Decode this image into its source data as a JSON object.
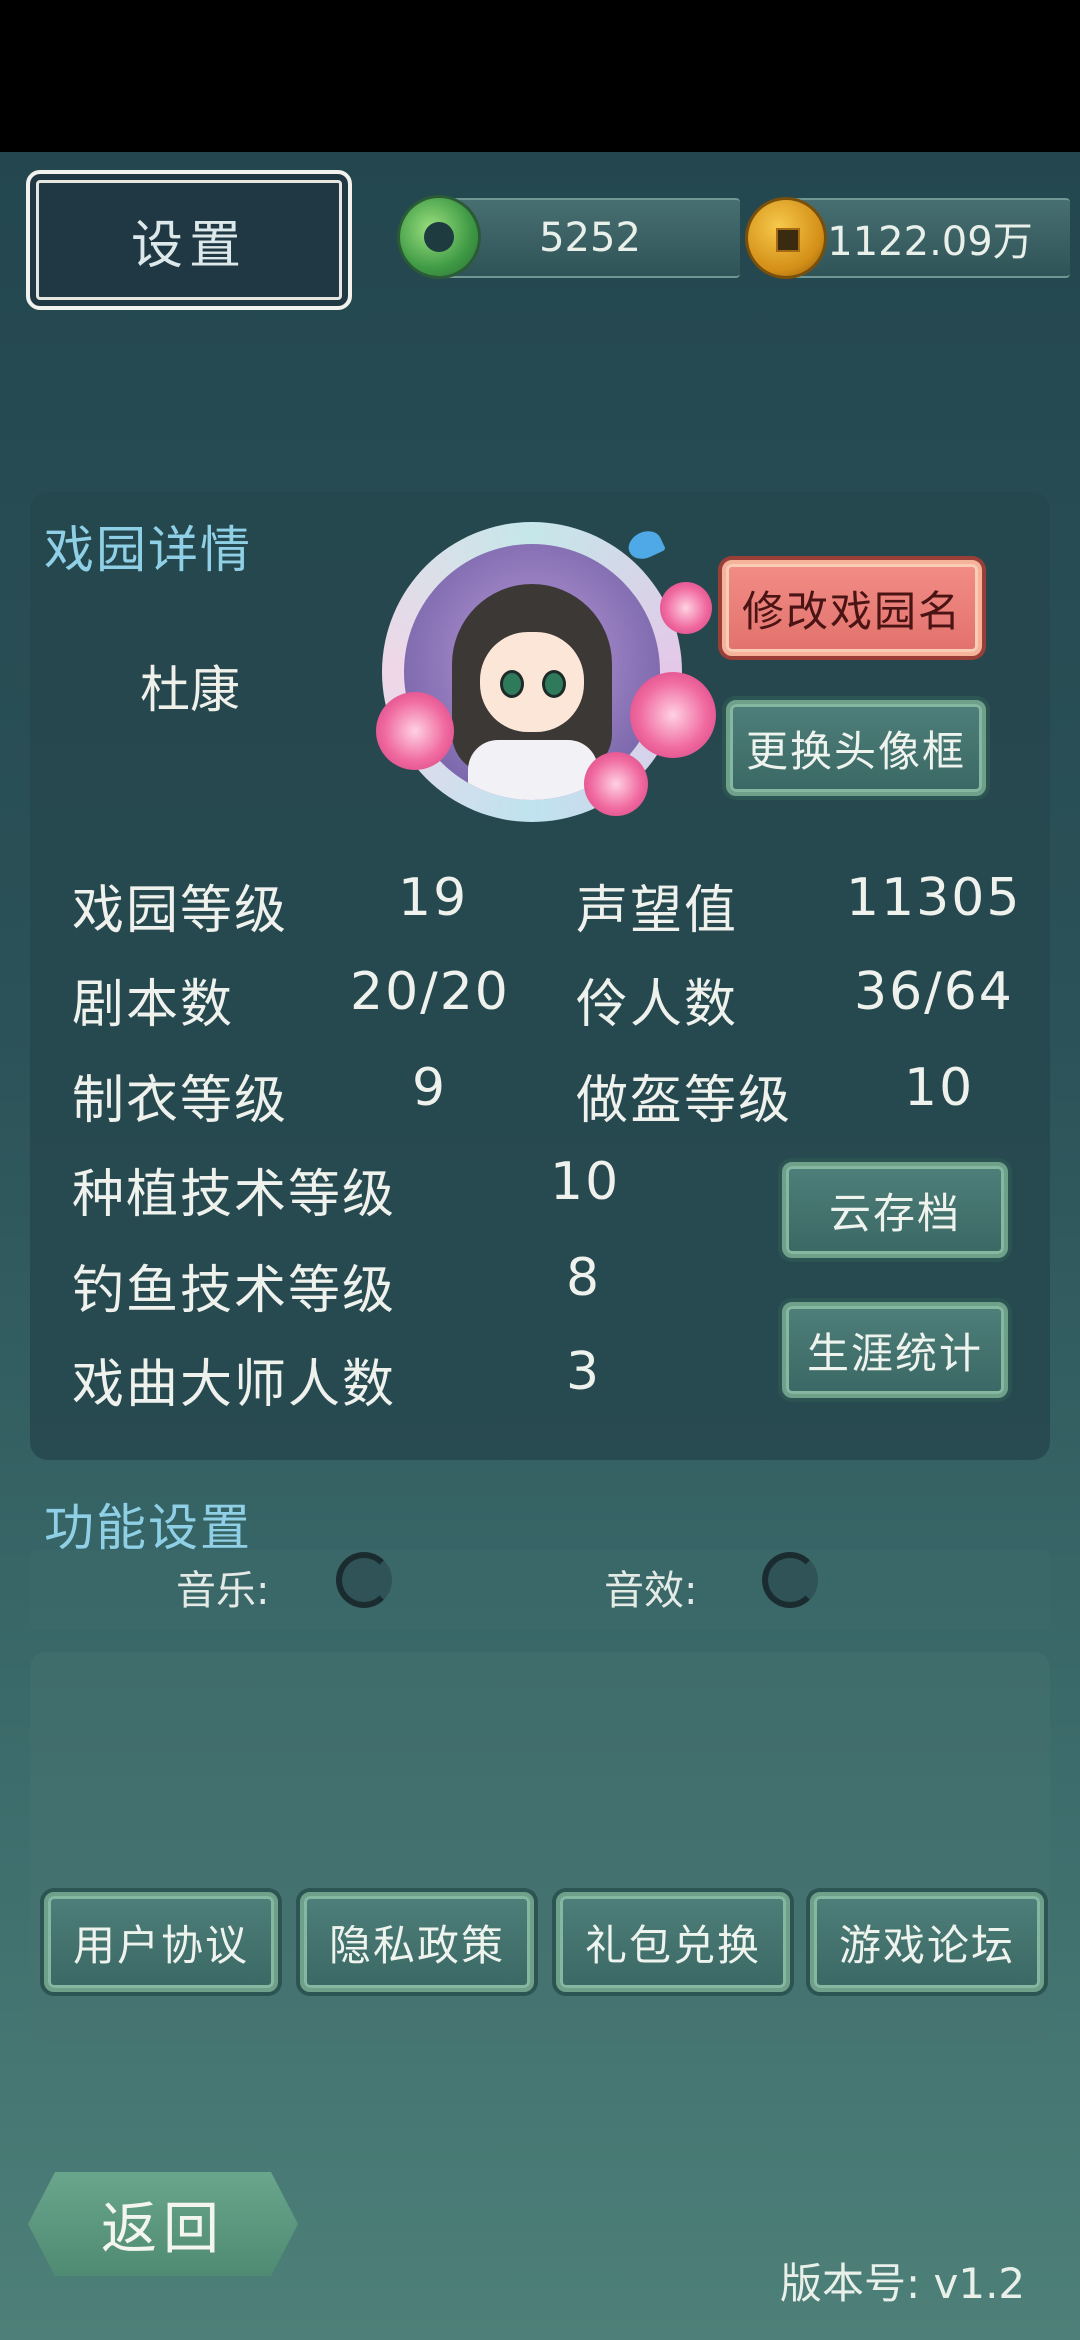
{
  "header": {
    "title": "设置",
    "jade_amount": "5252",
    "coin_amount": "1122.09万"
  },
  "details": {
    "section_title": "戏园详情",
    "garden_name": "杜康",
    "rename_button": "修改戏园名",
    "change_frame_button": "更换头像框",
    "stats": [
      {
        "label": "戏园等级",
        "value": "19"
      },
      {
        "label": "声望值",
        "value": "11305"
      },
      {
        "label": "剧本数",
        "value": "20/20"
      },
      {
        "label": "伶人数",
        "value": "36/64"
      },
      {
        "label": "制衣等级",
        "value": "9"
      },
      {
        "label": "做盔等级",
        "value": "10"
      },
      {
        "label": "种植技术等级",
        "value": "10"
      },
      {
        "label": "钓鱼技术等级",
        "value": "8"
      },
      {
        "label": "戏曲大师人数",
        "value": "3"
      }
    ],
    "cloud_save_button": "云存档",
    "career_stats_button": "生涯统计"
  },
  "functions": {
    "section_title": "功能设置",
    "music_label": "音乐:",
    "sfx_label": "音效:"
  },
  "links": [
    "用户协议",
    "隐私政策",
    "礼包兑换",
    "游戏论坛"
  ],
  "footer": {
    "back_button": "返回",
    "version": "版本号: v1.2"
  },
  "colors": {
    "accent_title": "#8fd0e6",
    "button_green": "#4f7f7a",
    "button_red": "#e2716c"
  },
  "icons": [
    "jade-currency-icon",
    "copper-coin-icon",
    "avatar-portrait"
  ]
}
